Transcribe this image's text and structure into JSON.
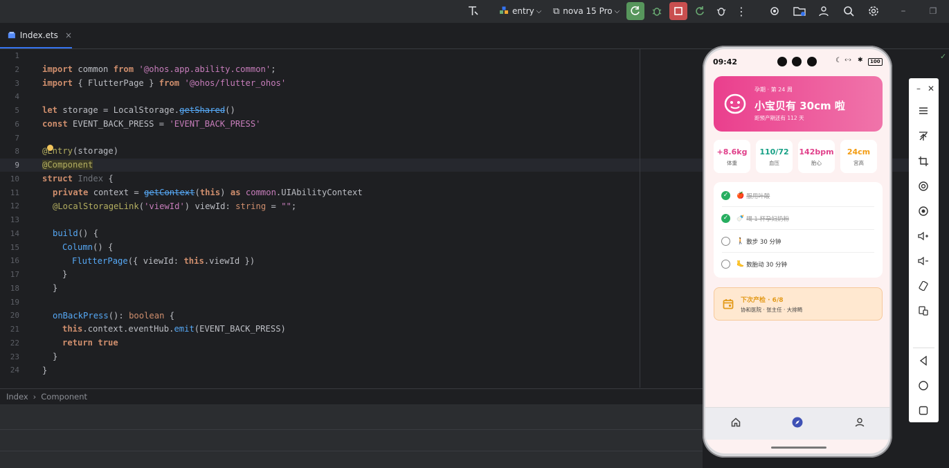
{
  "toolbar": {
    "config_name": "entry",
    "device_name": "nova 15 Pro"
  },
  "tab": {
    "file_name": "Index.ets",
    "close": "×"
  },
  "code_lines": [
    {
      "n": "1"
    },
    {
      "n": "2"
    },
    {
      "n": "3"
    },
    {
      "n": "4"
    },
    {
      "n": "5"
    },
    {
      "n": "6"
    },
    {
      "n": "7"
    },
    {
      "n": "8"
    },
    {
      "n": "9"
    },
    {
      "n": "10"
    },
    {
      "n": "11"
    },
    {
      "n": "12"
    },
    {
      "n": "13"
    },
    {
      "n": "14"
    },
    {
      "n": "15"
    },
    {
      "n": "16"
    },
    {
      "n": "17"
    },
    {
      "n": "18"
    },
    {
      "n": "19"
    },
    {
      "n": "20"
    },
    {
      "n": "21"
    },
    {
      "n": "22"
    },
    {
      "n": "23"
    },
    {
      "n": "24"
    }
  ],
  "code": {
    "l2": [
      "import",
      " common ",
      "from",
      " ",
      "'@ohos.app.ability.common'",
      ";"
    ],
    "l3": [
      "import",
      " { FlutterPage } ",
      "from",
      " ",
      "'@ohos/flutter_ohos'"
    ],
    "l5": [
      "let",
      " storage = LocalStorage.",
      "getShared",
      "()"
    ],
    "l6": [
      "const",
      " EVENT_BACK_PRESS = ",
      "'EVENT_BACK_PRESS'"
    ],
    "l8": [
      "@Entry",
      "(storage)"
    ],
    "l9": [
      "@Component"
    ],
    "l10": [
      "struct",
      " ",
      "Index",
      " {"
    ],
    "l11": [
      "private",
      " context = ",
      "getContext",
      "(",
      "this",
      ") ",
      "as",
      " ",
      "common",
      ".UIAbilityContext"
    ],
    "l12": [
      "@LocalStorageLink",
      "(",
      "'viewId'",
      ") viewId: ",
      "string",
      " = ",
      "\"\"",
      ";"
    ],
    "l14": [
      "build",
      "() {"
    ],
    "l15": [
      "Column",
      "() {"
    ],
    "l16": [
      "FlutterPage",
      "({ viewId: ",
      "this",
      ".viewId })"
    ],
    "l17": [
      "}"
    ],
    "l18": [
      "}"
    ],
    "l20": [
      "onBackPress",
      "(): ",
      "boolean",
      " {"
    ],
    "l21": [
      "this",
      ".context.eventHub.",
      "emit",
      "(EVENT_BACK_PRESS)"
    ],
    "l22": [
      "return",
      " ",
      "true"
    ],
    "l23": [
      "}"
    ],
    "l24": [
      "}"
    ]
  },
  "breadcrumb": {
    "item1": "Index",
    "sep": "›",
    "item2": "Component"
  },
  "phone": {
    "time": "09:42",
    "battery": "100",
    "hero": {
      "week": "孕期 · 第 24 周",
      "headline": "小宝贝有 30cm 啦",
      "sub": "距预产期还有 112 天"
    },
    "stats": [
      {
        "value": "+8.6kg",
        "label": "体重",
        "color": "#e0408a"
      },
      {
        "value": "110/72",
        "label": "血压",
        "color": "#16a085"
      },
      {
        "value": "142bpm",
        "label": "胎心",
        "color": "#e0408a"
      },
      {
        "value": "24cm",
        "label": "宫高",
        "color": "#f39c12"
      }
    ],
    "tasks": [
      {
        "emoji": "🍎",
        "text": "服用叶酸",
        "done": true
      },
      {
        "emoji": "🍼",
        "text": "喝 1 杯孕妇奶粉",
        "done": true
      },
      {
        "emoji": "🚶",
        "text": "散步 30 分钟",
        "done": false
      },
      {
        "emoji": "🦶",
        "text": "数胎动 30 分钟",
        "done": false
      }
    ],
    "next_checkup": {
      "title": "下次产检 · 6/8",
      "detail": "协和医院 · 张主任 · 大排畸"
    }
  }
}
